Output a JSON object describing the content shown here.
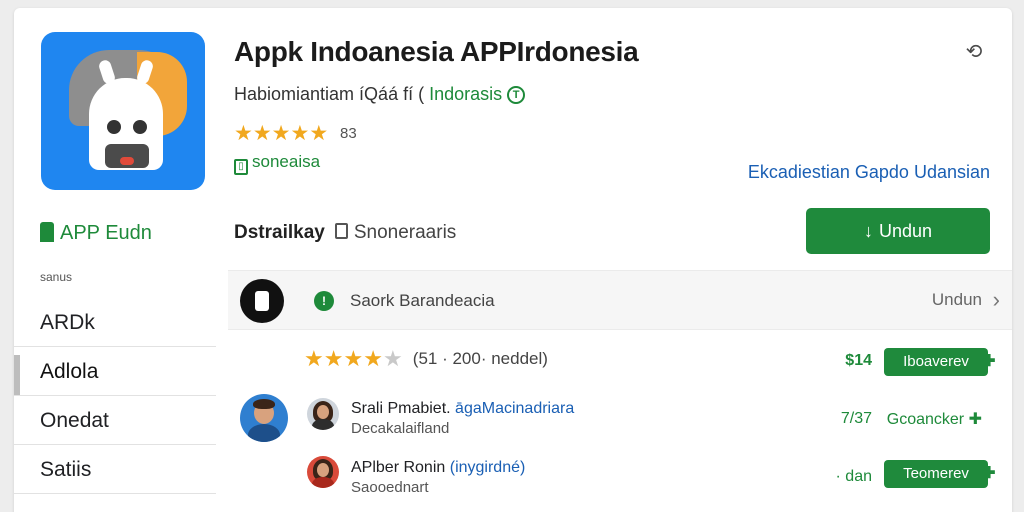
{
  "app": {
    "title": "Appk Indoanesia APPIrdonesia",
    "subtitle_text": "Habiomiantiam íQáá fí (",
    "subtitle_region": "Indorasis",
    "subtitle_badge": "T",
    "rating_stars": 4.5,
    "rating_count": "83",
    "category": "soneaisa",
    "developer_link": "Ekcadiestian Gapdo Udansian"
  },
  "left_panel": {
    "label": "APP Eudn",
    "caption": "sanus",
    "nav_items": [
      {
        "label": "ARDk"
      },
      {
        "label": "Adlola"
      },
      {
        "label": "Onedat"
      },
      {
        "label": "Satiis"
      }
    ]
  },
  "info_row": {
    "bold_text": "Dstrailkay",
    "light_text": "Snoneraaris"
  },
  "download_button": {
    "label": "Undun"
  },
  "list_header": {
    "label": "Saork Barandeacia",
    "right_text": "Undun"
  },
  "rows": [
    {
      "rating_stars": 3.5,
      "rating_text": "(51 · 200· neddel)",
      "price": "$14",
      "button": "Iboaverev"
    },
    {
      "name": "Srali Pmabiet.",
      "tag": "āgaMacinadriara",
      "subtitle": "Decakalaifland",
      "price": "7/37",
      "link": "Gcoancker"
    },
    {
      "name": "APlber Ronin",
      "tag": "(inygirdné)",
      "subtitle": "Saooednart",
      "price": "· dan",
      "button": "Teomerev"
    }
  ],
  "colors": {
    "accent_green": "#1f8a3c",
    "link_blue": "#1a5fb4",
    "star_gold": "#f1a81e",
    "icon_blue": "#1f86f0"
  }
}
